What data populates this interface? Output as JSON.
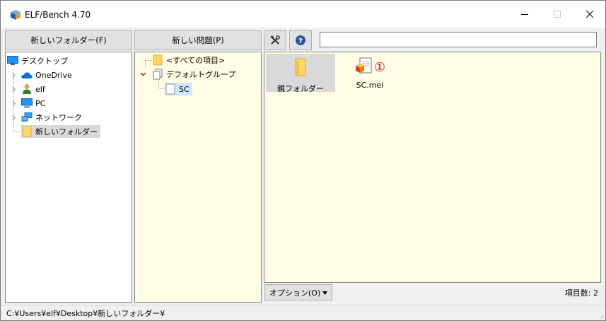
{
  "window": {
    "title": "ELF/Bench 4.70"
  },
  "toolbar": {
    "new_folder_label": "新しいフォルダー(F)",
    "new_problem_label": "新しい問題(P)",
    "settings_icon": "tools-icon",
    "help_icon": "question-icon",
    "search_value": ""
  },
  "folder_tree": {
    "items": [
      {
        "label": "デスクトップ",
        "icon": "desktop-icon"
      },
      {
        "label": "OneDrive",
        "icon": "cloud-icon"
      },
      {
        "label": "elf",
        "icon": "user-icon"
      },
      {
        "label": "PC",
        "icon": "monitor-icon"
      },
      {
        "label": "ネットワーク",
        "icon": "network-icon"
      },
      {
        "label": "新しいフォルダー",
        "icon": "folder-icon",
        "selected": true
      }
    ]
  },
  "problem_tree": {
    "items": [
      {
        "label": "<すべての項目>",
        "icon": "folder-icon"
      },
      {
        "label": "デフォルトグループ",
        "icon": "group-icon"
      },
      {
        "label": "SC",
        "icon": "document-icon",
        "selected": true
      }
    ]
  },
  "file_view": {
    "items": [
      {
        "label": "親フォルダー",
        "icon": "folder-icon",
        "selected": true
      },
      {
        "label": "SC.mei",
        "icon": "mei-file-icon",
        "badge": "①"
      }
    ],
    "options_label": "オプション(O)",
    "item_count": "項目数: 2"
  },
  "status_bar": {
    "path": "C:¥Users¥elf¥Desktop¥新しいフォルダー¥"
  },
  "colors": {
    "accent_yellow_bg": "#fffde3",
    "badge_red": "#e00000",
    "selection_gray": "#d9d9d9"
  }
}
